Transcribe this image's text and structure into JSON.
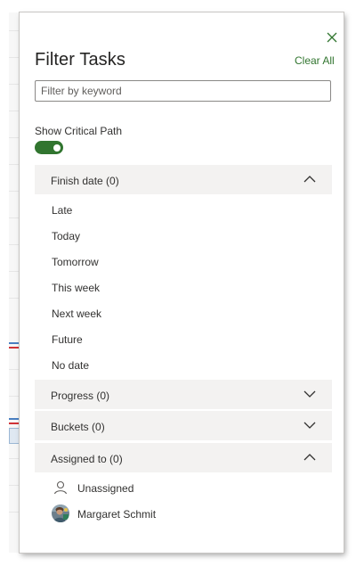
{
  "panel": {
    "title": "Filter Tasks",
    "clear_all": "Clear All",
    "keyword_placeholder": "Filter by keyword",
    "keyword_value": ""
  },
  "critical_path": {
    "label": "Show Critical Path",
    "enabled": true
  },
  "sections": {
    "finish_date": {
      "label": "Finish date (0)",
      "expanded": true,
      "options": [
        "Late",
        "Today",
        "Tomorrow",
        "This week",
        "Next week",
        "Future",
        "No date"
      ]
    },
    "progress": {
      "label": "Progress (0)",
      "expanded": false
    },
    "buckets": {
      "label": "Buckets (0)",
      "expanded": false
    },
    "assigned_to": {
      "label": "Assigned to (0)",
      "expanded": true,
      "people": [
        "Unassigned",
        "Margaret Schmit"
      ]
    }
  },
  "colors": {
    "accent": "#31752f",
    "section_bg": "#f3f2f1",
    "text": "#323130"
  },
  "icons": [
    "close-icon",
    "chevron-up-icon",
    "chevron-down-icon",
    "person-icon",
    "avatar"
  ]
}
